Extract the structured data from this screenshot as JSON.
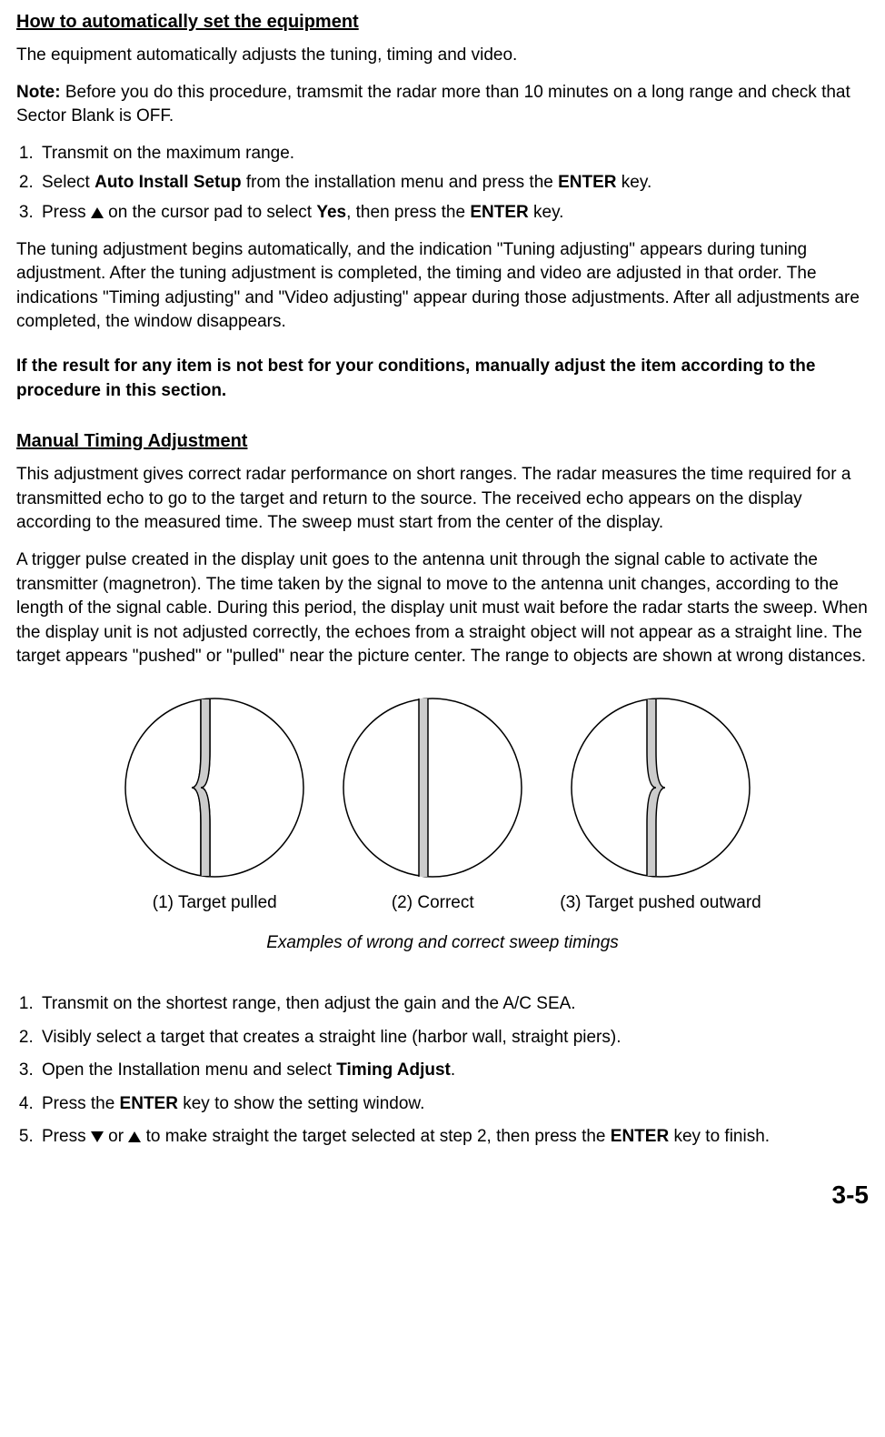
{
  "section1": {
    "heading": "How to automatically set the equipment",
    "para1": "The equipment automatically adjusts the tuning, timing and video.",
    "noteLabel": "Note:",
    "noteText": " Before you do this procedure, tramsmit the radar more than 10 minutes on a long range and check that Sector Blank is OFF.",
    "steps": {
      "s1": "Transmit on the maximum range.",
      "s2a": "Select ",
      "s2b": "Auto Install Setup",
      "s2c": " from the installation menu and press the ",
      "s2d": "ENTER",
      "s2e": " key.",
      "s3a": "Press ",
      "s3b": " on the cursor pad to select ",
      "s3c": "Yes",
      "s3d": ", then press the ",
      "s3e": "ENTER",
      "s3f": " key."
    },
    "para2": "The tuning adjustment begins automatically, and the indication \"Tuning adjusting\" appears during tuning adjustment. After the tuning adjustment is completed, the timing and video are adjusted in that order. The indications \"Timing adjusting\" and \"Video adjusting\" appear during those adjustments. After all adjustments are completed, the window disappears.",
    "para3": "If the result for any item is not best for your conditions, manually adjust the item according to the procedure in this section."
  },
  "section2": {
    "heading": "Manual Timing Adjustment",
    "para1": "This adjustment gives correct radar performance on short ranges. The radar measures the time required for a transmitted echo to go to the target and return to the source. The received echo appears on the display according to the measured time. The sweep must start from the center of the display.",
    "para2": "A trigger pulse created in the display unit goes to the antenna unit through the signal cable to activate the transmitter (magnetron). The time taken by the signal to move to the antenna unit changes, according to the length of the signal cable. During this period, the display unit must wait before the radar starts the sweep. When the display unit is not adjusted correctly, the echoes from a straight object will not appear as a straight line. The target appears \"pushed\" or \"pulled\" near the picture center. The range to objects are shown at wrong distances.",
    "figLabels": {
      "f1": "(1) Target pulled",
      "f2": "(2) Correct",
      "f3": "(3) Target pushed outward"
    },
    "figCaption": "Examples of wrong and correct sweep timings",
    "steps": {
      "s1": "Transmit on the shortest range, then adjust the gain and the A/C SEA.",
      "s2": "Visibly select a target that creates a straight line (harbor wall, straight piers).",
      "s3a": "Open the Installation menu and select ",
      "s3b": "Timing Adjust",
      "s3c": ".",
      "s4a": "Press the ",
      "s4b": "ENTER",
      "s4c": " key to show the setting window.",
      "s5a": "Press ",
      "s5b": " or ",
      "s5c": " to make straight the target selected at step 2, then press the ",
      "s5d": "ENTER",
      "s5e": " key to finish."
    }
  },
  "pageNumber": "3-5"
}
